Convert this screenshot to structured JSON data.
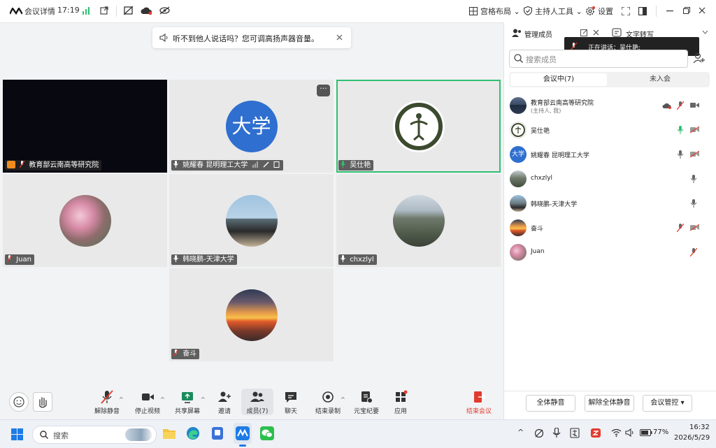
{
  "window": {
    "title": "会议详情",
    "time": "17:19",
    "layout_label": "宫格布局",
    "host_tools_label": "主持人工具",
    "settings_label": "设置"
  },
  "notice": {
    "text": "听不到他人说话吗？您可调高扬声器音量。"
  },
  "tiles": [
    {
      "name": "教育部云南高等研究院"
    },
    {
      "name": "姚耀春 昆明理工大学",
      "avatar_text": "大学"
    },
    {
      "name": "吴仕艳"
    },
    {
      "name": "Juan"
    },
    {
      "name": "韩晓鹏-天津大学"
    },
    {
      "name": "chxzlyl"
    },
    {
      "name": "奋斗"
    }
  ],
  "toolbar": {
    "buttons": [
      {
        "label": "解除静音"
      },
      {
        "label": "停止视频"
      },
      {
        "label": "共享屏幕"
      },
      {
        "label": "邀请"
      },
      {
        "label": "成员(7)"
      },
      {
        "label": "聊天"
      },
      {
        "label": "结束录制"
      },
      {
        "label": "元宝纪要"
      },
      {
        "label": "应用"
      }
    ],
    "end_label": "结束会议"
  },
  "panel": {
    "tab_members": "管理成员",
    "tab_transcript": "文字转写",
    "speaking_prefix": "正在讲话：",
    "speaking_name": "吴仕艳:",
    "search_placeholder": "搜索成员",
    "tab_in_meeting": "会议中(7)",
    "tab_not_joined": "未入会",
    "members": [
      {
        "name": "教育部云南高等研究院",
        "sub": "(主持人, 我)"
      },
      {
        "name": "吴仕艳"
      },
      {
        "name": "姚耀春 昆明理工大学",
        "avatar_text": "大学"
      },
      {
        "name": "chxzlyl"
      },
      {
        "name": "韩晓鹏-天津大学"
      },
      {
        "name": "奋斗"
      },
      {
        "name": "Juan"
      }
    ],
    "mute_all": "全体静音",
    "unmute_all": "解除全体静音",
    "meeting_control": "会议管控"
  },
  "taskbar": {
    "search_placeholder": "搜索",
    "time": "16:32",
    "date": "2026/5/29",
    "battery": "77%"
  },
  "colors": {
    "accent": "#1e7be6",
    "speaking_border": "#2fbf71",
    "end_red": "#e23b2e"
  }
}
